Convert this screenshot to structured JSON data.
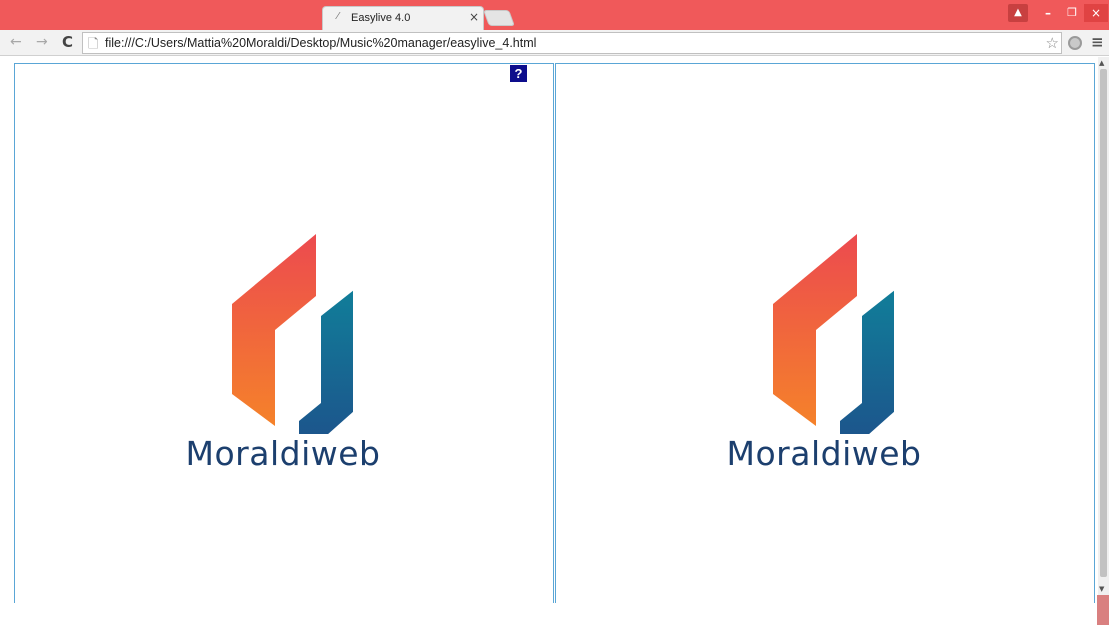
{
  "browser": {
    "tab_title": "Easylive 4.0",
    "tab_favicon": "page-icon",
    "tab_close": "×",
    "url": "file:///C:/Users/Mattia%20Moraldi/Desktop/Music%20manager/easylive_4.html"
  },
  "window_controls": {
    "user": "▲",
    "minimize": "–",
    "maximize": "❐",
    "close": "×"
  },
  "nav": {
    "back": "←",
    "forward": "→",
    "reload": "C"
  },
  "page": {
    "help_label": "?",
    "left_logo_text": "Moraldiweb",
    "right_logo_text": "Moraldiweb"
  },
  "colors": {
    "accent_border": "#5aa6d6",
    "help_bg": "#0d0d8c",
    "logo_orange_top": "#ec4a4f",
    "logo_orange_bottom": "#f5822a",
    "logo_blue_top": "#10809a",
    "logo_blue_bottom": "#1e4f8a",
    "wordmark": "#1c3f6e"
  }
}
